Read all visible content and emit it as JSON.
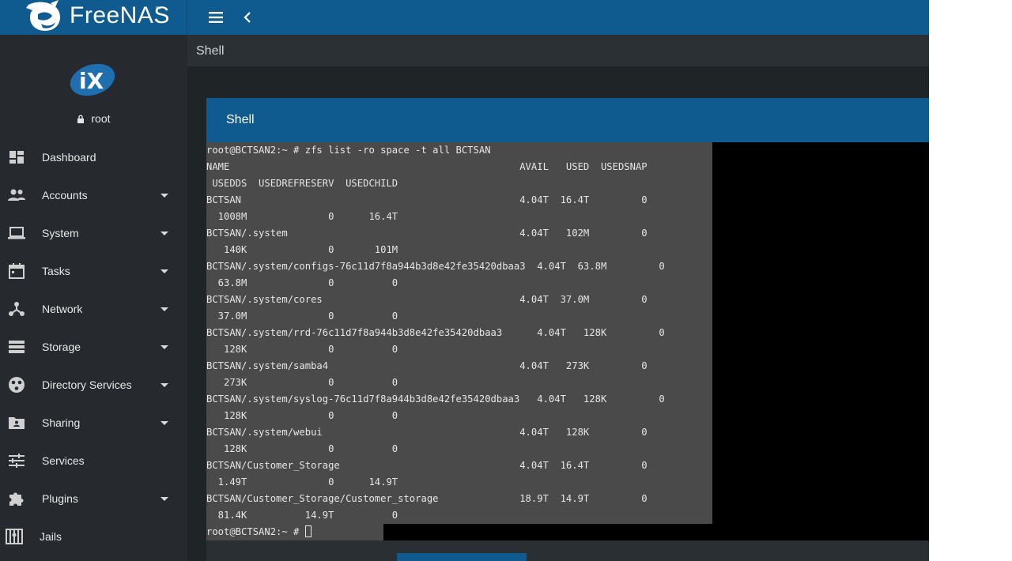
{
  "brand": {
    "name": "FreeNAS",
    "tm": "™"
  },
  "user": {
    "name": "root"
  },
  "nav": [
    {
      "label": "Dashboard",
      "icon": "dashboard-icon",
      "has_caret": false
    },
    {
      "label": "Accounts",
      "icon": "accounts-icon",
      "has_caret": true
    },
    {
      "label": "System",
      "icon": "laptop-icon",
      "has_caret": true
    },
    {
      "label": "Tasks",
      "icon": "calendar-icon",
      "has_caret": true
    },
    {
      "label": "Network",
      "icon": "network-icon",
      "has_caret": true
    },
    {
      "label": "Storage",
      "icon": "storage-icon",
      "has_caret": true
    },
    {
      "label": "Directory Services",
      "icon": "directory-services-icon",
      "has_caret": true
    },
    {
      "label": "Sharing",
      "icon": "shared-folder-icon",
      "has_caret": true
    },
    {
      "label": "Services",
      "icon": "sliders-icon",
      "has_caret": false
    },
    {
      "label": "Plugins",
      "icon": "puzzle-icon",
      "has_caret": true
    },
    {
      "label": "Jails",
      "icon": "jail-icon",
      "has_caret": false
    }
  ],
  "page": {
    "title": "Shell"
  },
  "card": {
    "title": "Shell"
  },
  "terminal": {
    "lines": [
      "root@BCTSAN2:~ # zfs list -ro space -t all BCTSAN",
      "NAME                                                  AVAIL   USED  USEDSNAP",
      " USEDDS  USEDREFRESERV  USEDCHILD",
      "BCTSAN                                                4.04T  16.4T         0",
      "  1008M              0      16.4T",
      "BCTSAN/.system                                        4.04T   102M         0",
      "   140K              0       101M",
      "BCTSAN/.system/configs-76c11d7f8a944b3d8e42fe35420dbaa3  4.04T  63.8M         0",
      "  63.8M              0          0",
      "BCTSAN/.system/cores                                  4.04T  37.0M         0",
      "  37.0M              0          0",
      "BCTSAN/.system/rrd-76c11d7f8a944b3d8e42fe35420dbaa3      4.04T   128K         0",
      "   128K              0          0",
      "BCTSAN/.system/samba4                                 4.04T   273K         0",
      "   273K              0          0",
      "BCTSAN/.system/syslog-76c11d7f8a944b3d8e42fe35420dbaa3   4.04T   128K         0",
      "   128K              0          0",
      "BCTSAN/.system/webui                                  4.04T   128K         0",
      "   128K              0          0",
      "BCTSAN/Customer_Storage                               4.04T  16.4T         0",
      "  1.49T              0      14.9T",
      "BCTSAN/Customer_Storage/Customer_storage              18.9T  14.9T         0",
      "  81.4K          14.9T          0"
    ],
    "prompt": "root@BCTSAN2:~ # "
  },
  "colors": {
    "topbar": "#0f5a8f",
    "sidebar": "#262a2e",
    "terminal_bg": "#000000",
    "selection": "#4a4a4a"
  }
}
